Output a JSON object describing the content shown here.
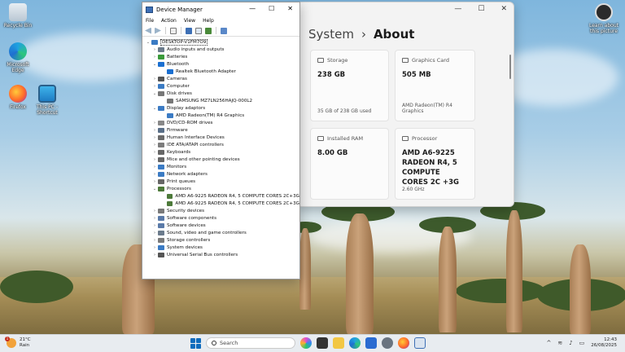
{
  "desktop": {
    "icons": [
      {
        "label": "Recycle Bin",
        "icon": "recycle-bin-icon"
      },
      {
        "label": "Microsoft Edge",
        "icon": "edge-icon"
      },
      {
        "label": "Firefox",
        "icon": "firefox-icon"
      },
      {
        "label": "This PC - Shortcut",
        "icon": "this-pc-icon"
      },
      {
        "label": "Learn about this picture",
        "icon": "camera-icon"
      }
    ]
  },
  "settings": {
    "breadcrumb_parent": "System",
    "breadcrumb_separator": "›",
    "breadcrumb_current": "About",
    "cards": {
      "storage": {
        "label": "Storage",
        "value": "238 GB",
        "sub": "35 GB of 238 GB used"
      },
      "graphics": {
        "label": "Graphics Card",
        "value": "505 MB",
        "sub": "AMD Radeon(TM) R4 Graphics"
      },
      "ram": {
        "label": "Installed RAM",
        "value": "8.00 GB"
      },
      "processor": {
        "label": "Processor",
        "value": "AMD A6-9225 RADEON R4, 5 COMPUTE CORES 2C +3G",
        "sub": "2.60 GHz"
      }
    }
  },
  "device_manager": {
    "title": "Device Manager",
    "menu": [
      "File",
      "Action",
      "View",
      "Help"
    ],
    "root": "DESKTOP-V1FM7O9",
    "tree": [
      {
        "label": "Audio inputs and outputs",
        "expanded": false,
        "color": "#6b7b8c"
      },
      {
        "label": "Batteries",
        "expanded": false,
        "color": "#3a9a3a"
      },
      {
        "label": "Bluetooth",
        "expanded": true,
        "color": "#1a6fd1",
        "children": [
          "Realtek Bluetooth Adapter"
        ]
      },
      {
        "label": "Cameras",
        "expanded": false,
        "color": "#555555"
      },
      {
        "label": "Computer",
        "expanded": false,
        "color": "#3b7bc4"
      },
      {
        "label": "Disk drives",
        "expanded": true,
        "color": "#777777",
        "children": [
          "SAMSUNG MZ7LN256HAJQ-000L2"
        ]
      },
      {
        "label": "Display adaptors",
        "expanded": true,
        "color": "#3b7bc4",
        "children": [
          "AMD Radeon(TM) R4 Graphics"
        ]
      },
      {
        "label": "DVD/CD-ROM drives",
        "expanded": false,
        "color": "#888888"
      },
      {
        "label": "Firmware",
        "expanded": false,
        "color": "#5a6f88"
      },
      {
        "label": "Human Interface Devices",
        "expanded": false,
        "color": "#6c6c6c"
      },
      {
        "label": "IDE ATA/ATAPI controllers",
        "expanded": false,
        "color": "#7c7c7c"
      },
      {
        "label": "Keyboards",
        "expanded": false,
        "color": "#666666"
      },
      {
        "label": "Mice and other pointing devices",
        "expanded": false,
        "color": "#666666"
      },
      {
        "label": "Monitors",
        "expanded": false,
        "color": "#3b7bc4"
      },
      {
        "label": "Network adapters",
        "expanded": false,
        "color": "#3b7bc4"
      },
      {
        "label": "Print queues",
        "expanded": false,
        "color": "#666666"
      },
      {
        "label": "Processors",
        "expanded": true,
        "color": "#4d7a3a",
        "children": [
          "AMD A6-9225 RADEON R4, 5 COMPUTE CORES 2C+3G",
          "AMD A6-9225 RADEON R4, 5 COMPUTE CORES 2C+3G"
        ]
      },
      {
        "label": "Security devices",
        "expanded": false,
        "color": "#7a7a7a"
      },
      {
        "label": "Software components",
        "expanded": false,
        "color": "#5a7aa8"
      },
      {
        "label": "Software devices",
        "expanded": false,
        "color": "#5a7aa8"
      },
      {
        "label": "Sound, video and game controllers",
        "expanded": false,
        "color": "#6b7b8c"
      },
      {
        "label": "Storage controllers",
        "expanded": false,
        "color": "#7a7a7a"
      },
      {
        "label": "System devices",
        "expanded": false,
        "color": "#3b7bc4"
      },
      {
        "label": "Universal Serial Bus controllers",
        "expanded": false,
        "color": "#555555"
      }
    ]
  },
  "taskbar": {
    "weather_temp": "21°C",
    "weather_desc": "Rain",
    "weather_badge": "1",
    "search_placeholder": "Search",
    "time": "12:43",
    "date": "26/08/2025"
  }
}
